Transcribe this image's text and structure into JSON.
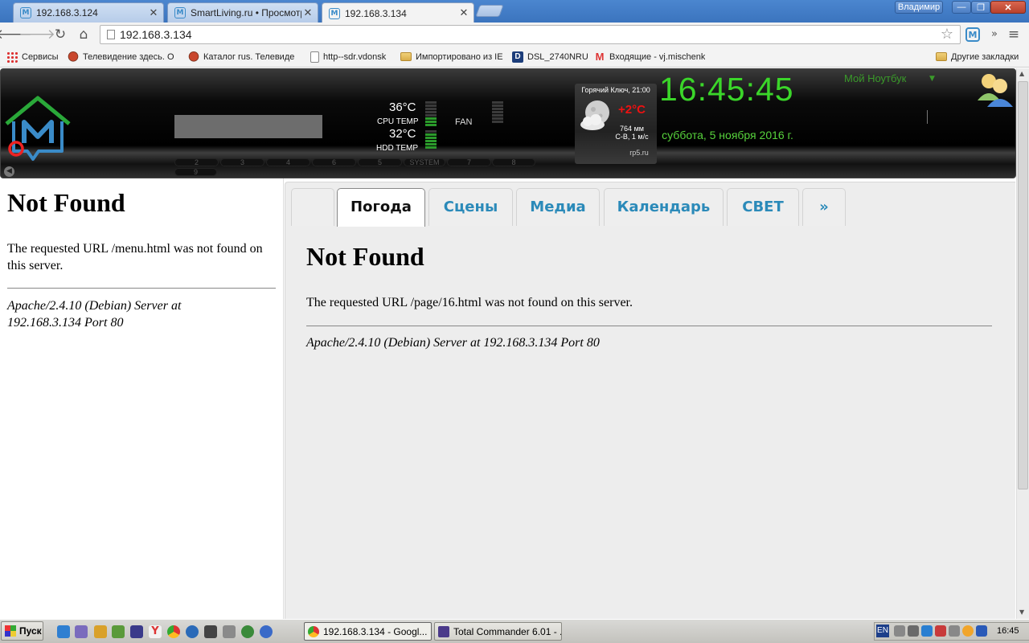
{
  "browser": {
    "tabs": [
      {
        "label": "192.168.3.124"
      },
      {
        "label": "SmartLiving.ru • Просмотр т"
      },
      {
        "label": "192.168.3.134"
      }
    ],
    "user": "Владимир",
    "window_buttons": {
      "minimize": "—",
      "maximize": "❐",
      "close": "✕"
    },
    "address": "192.168.3.134",
    "extension_icon_letter": "M"
  },
  "bookmarks": [
    {
      "label": "Сервисы",
      "icon": "apps-icon"
    },
    {
      "label": "Телевидение здесь. О",
      "icon": "tv-icon"
    },
    {
      "label": "Каталог rus. Телевиде",
      "icon": "tv-icon"
    },
    {
      "label": "http--sdr.vdonsk",
      "icon": "page-icon"
    },
    {
      "label": "Импортировано из IE",
      "icon": "folder-icon"
    },
    {
      "label": "DSL_2740NRU",
      "icon": "dsl-icon"
    },
    {
      "label": "Входящие - vj.mischenk",
      "icon": "gmail-icon"
    },
    {
      "label": "Другие закладки",
      "icon": "folder-icon"
    }
  ],
  "dashboard": {
    "cpu_temp": "36°C",
    "cpu_label": "CPU TEMP",
    "hdd_temp": "32°C",
    "hdd_label": "HDD TEMP",
    "fan_label": "FAN",
    "pills": [
      "2",
      "3",
      "4",
      "6",
      "5",
      "SYSTEM",
      "7",
      "8",
      "9"
    ],
    "weather": {
      "city_time": "Горячий Ключ, 21:00",
      "temp": "+2°C",
      "pressure": "764 мм",
      "wind": "С-В, 1 м/с",
      "source": "rp5.ru",
      "icon": "cloud-moon-icon"
    },
    "clock": "16:45:45",
    "date": "суббота,  5 ноября 2016 г.",
    "device": "Мой Ноутбук",
    "colors": {
      "clock": "#3bd62a",
      "weather_temp": "#e11111",
      "logo": "#2aa839"
    }
  },
  "left_frame": {
    "heading": "Not Found",
    "message": "The requested URL /menu.html was not found on this server.",
    "address": "Apache/2.4.10 (Debian) Server at 192.168.3.134 Port 80"
  },
  "right_frame": {
    "tabs": [
      "",
      "Погода",
      "Сцены",
      "Медиа",
      "Календарь",
      "СВЕТ",
      "»"
    ],
    "active_tab": "Погода",
    "heading": "Not Found",
    "message": "The requested URL /page/16.html was not found on this server.",
    "address": "Apache/2.4.10 (Debian) Server at 192.168.3.134 Port 80"
  },
  "taskbar": {
    "start": "Пуск",
    "tasks": [
      {
        "label": "192.168.3.134 - Googl...",
        "active": true
      },
      {
        "label": "Total Commander 6.01 - ...",
        "active": false
      }
    ],
    "lang": "EN",
    "clock": "16:45"
  }
}
